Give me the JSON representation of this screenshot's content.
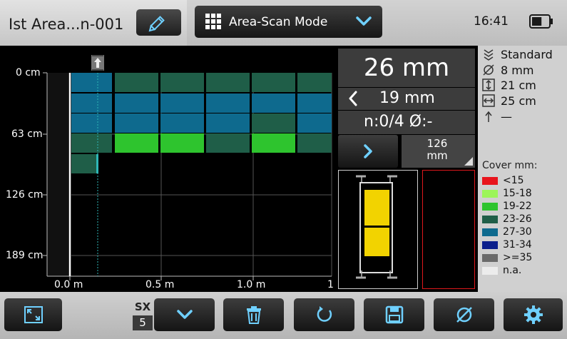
{
  "header": {
    "file_title": "Ist Area...n-001",
    "mode_label": "Area-Scan Mode",
    "time": "16:41",
    "battery_level": 0.6
  },
  "chart": {
    "y_labels": [
      "0 cm",
      "63 cm",
      "126 cm",
      "189 cm"
    ],
    "x_labels": [
      "0.0 m",
      "0.5 m",
      "1.0 m",
      "1"
    ],
    "colors": {
      "green_light": "#2ec42e",
      "green_dark": "#1f5e48",
      "blue": "#0e6a8e",
      "cursor": "#2fb7b7"
    },
    "grid_rows": [
      [
        "blue",
        "green_dark",
        "green_dark",
        "green_dark",
        "green_dark",
        "green_dark"
      ],
      [
        "blue",
        "blue",
        "blue",
        "blue",
        "blue",
        "blue"
      ],
      [
        "blue",
        "blue",
        "blue",
        "blue",
        "green_dark",
        "blue"
      ],
      [
        "green_dark",
        "green_light",
        "green_light",
        "green_dark",
        "green_light",
        "green_dark"
      ],
      [
        "green_dark"
      ]
    ]
  },
  "readout": {
    "depth": "26 mm",
    "previous_depth": "19 mm",
    "count": "n:0/4  Ø:-",
    "distance_value": "126",
    "distance_unit": "mm"
  },
  "info": {
    "profile": "Standard",
    "diameter": "8 mm",
    "spacing_y": "21 cm",
    "spacing_x": "25 cm",
    "direction_value": "—",
    "cover_title": "Cover mm:",
    "legend": [
      {
        "label": "<15",
        "color": "#e8141c"
      },
      {
        "label": "15-18",
        "color": "#9cf55a"
      },
      {
        "label": "19-22",
        "color": "#2ec42e"
      },
      {
        "label": "23-26",
        "color": "#1f5e48"
      },
      {
        "label": "27-30",
        "color": "#0e6a8e"
      },
      {
        "label": "31-34",
        "color": "#0b1f8c"
      },
      {
        "label": ">=35",
        "color": "#6a6a6a"
      },
      {
        "label": "n.a.",
        "color": "#ececec"
      }
    ]
  },
  "toolbar": {
    "sx_label": "SX",
    "sx_value": "5",
    "icons": [
      "fullscreen-icon",
      "chevron-down-icon",
      "trash-icon",
      "refresh-icon",
      "save-icon",
      "diameter-icon",
      "settings-icon"
    ]
  }
}
